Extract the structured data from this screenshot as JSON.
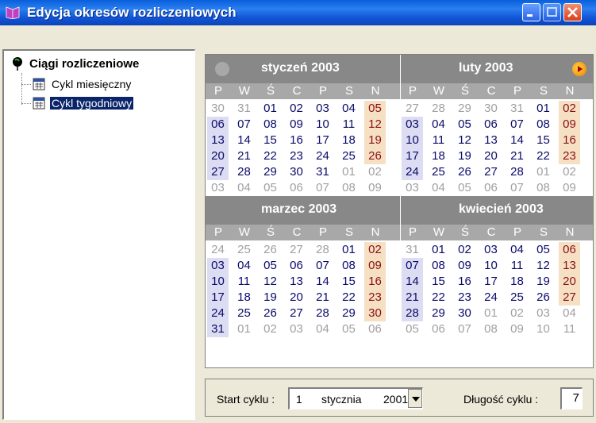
{
  "window": {
    "title": "Edycja okresów rozliczeniowych",
    "colors": {
      "titlebar": "#0a5fdc",
      "selection": "#0a246a",
      "month_header": "#888888",
      "highlight": "#f6e0c4"
    }
  },
  "tree": {
    "root_label": "Ciągi rozliczeniowe",
    "items": [
      {
        "label": "Cykl miesięczny",
        "icon": "calendar-page-icon",
        "selected": false
      },
      {
        "label": "Cykl tygodniowy",
        "icon": "calendar-page-icon",
        "selected": true
      }
    ]
  },
  "calendar": {
    "weekday_headers": [
      "P",
      "W",
      "Ś",
      "C",
      "P",
      "S",
      "N"
    ],
    "months": [
      {
        "title": "styczeń 2003",
        "weeks": [
          [
            "30",
            "31",
            "01",
            "02",
            "03",
            "04",
            "05"
          ],
          [
            "06",
            "07",
            "08",
            "09",
            "10",
            "11",
            "12"
          ],
          [
            "13",
            "14",
            "15",
            "16",
            "17",
            "18",
            "19"
          ],
          [
            "20",
            "21",
            "22",
            "23",
            "24",
            "25",
            "26"
          ],
          [
            "27",
            "28",
            "29",
            "30",
            "31",
            "01",
            "02"
          ],
          [
            "03",
            "04",
            "05",
            "06",
            "07",
            "08",
            "09"
          ]
        ],
        "first_in": 2,
        "last_in_index": 32
      },
      {
        "title": "luty 2003",
        "weeks": [
          [
            "27",
            "28",
            "29",
            "30",
            "31",
            "01",
            "02"
          ],
          [
            "03",
            "04",
            "05",
            "06",
            "07",
            "08",
            "09"
          ],
          [
            "10",
            "11",
            "12",
            "13",
            "14",
            "15",
            "16"
          ],
          [
            "17",
            "18",
            "19",
            "20",
            "21",
            "22",
            "23"
          ],
          [
            "24",
            "25",
            "26",
            "27",
            "28",
            "01",
            "02"
          ],
          [
            "03",
            "04",
            "05",
            "06",
            "07",
            "08",
            "09"
          ]
        ],
        "first_in": 5,
        "last_in_index": 32
      },
      {
        "title": "marzec 2003",
        "weeks": [
          [
            "24",
            "25",
            "26",
            "27",
            "28",
            "01",
            "02"
          ],
          [
            "03",
            "04",
            "05",
            "06",
            "07",
            "08",
            "09"
          ],
          [
            "10",
            "11",
            "12",
            "13",
            "14",
            "15",
            "16"
          ],
          [
            "17",
            "18",
            "19",
            "20",
            "21",
            "22",
            "23"
          ],
          [
            "24",
            "25",
            "26",
            "27",
            "28",
            "29",
            "30"
          ],
          [
            "31",
            "01",
            "02",
            "03",
            "04",
            "05",
            "06"
          ]
        ],
        "first_in": 5,
        "last_in_index": 35
      },
      {
        "title": "kwiecień 2003",
        "weeks": [
          [
            "31",
            "01",
            "02",
            "03",
            "04",
            "05",
            "06"
          ],
          [
            "07",
            "08",
            "09",
            "10",
            "11",
            "12",
            "13"
          ],
          [
            "14",
            "15",
            "16",
            "17",
            "18",
            "19",
            "20"
          ],
          [
            "21",
            "22",
            "23",
            "24",
            "25",
            "26",
            "27"
          ],
          [
            "28",
            "29",
            "30",
            "01",
            "02",
            "03",
            "04"
          ],
          [
            "05",
            "06",
            "07",
            "08",
            "09",
            "10",
            "11"
          ]
        ],
        "first_in": 1,
        "last_in_index": 30
      }
    ]
  },
  "footer": {
    "start_label": "Start cyklu :",
    "start_day": "1",
    "start_month": "stycznia",
    "start_year": "2001",
    "length_label": "Długość cyklu :",
    "length_value": "7"
  }
}
